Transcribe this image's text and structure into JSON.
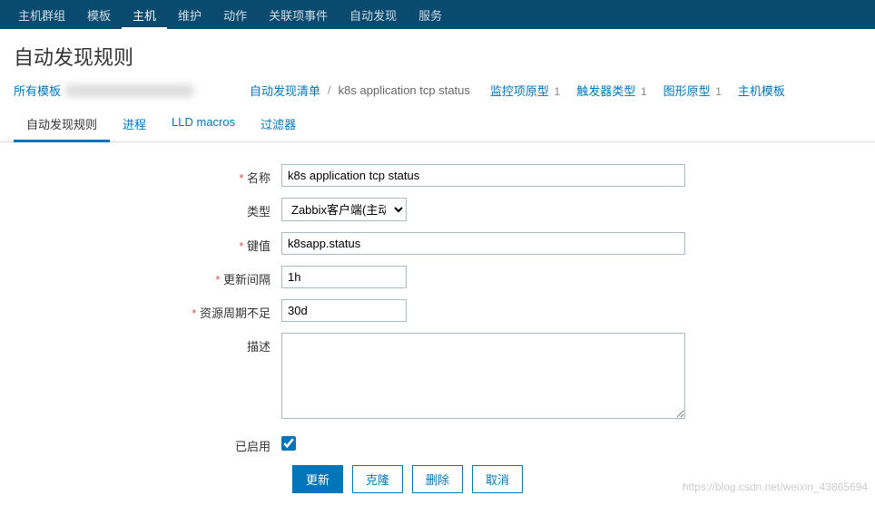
{
  "topnav": {
    "items": [
      {
        "label": "主机群组"
      },
      {
        "label": "模板"
      },
      {
        "label": "主机",
        "active": true
      },
      {
        "label": "维护"
      },
      {
        "label": "动作"
      },
      {
        "label": "关联项事件"
      },
      {
        "label": "自动发现"
      },
      {
        "label": "服务"
      }
    ]
  },
  "page_title": "自动发现规则",
  "breadcrumb": {
    "all_templates": "所有模板",
    "discovery_list": "自动发现清单",
    "current": "k8s application tcp status",
    "links": [
      {
        "label": "监控项原型",
        "count": "1"
      },
      {
        "label": "触发器类型",
        "count": "1"
      },
      {
        "label": "图形原型",
        "count": "1"
      },
      {
        "label": "主机模板"
      }
    ]
  },
  "tabs": [
    {
      "label": "自动发现规则",
      "active": true
    },
    {
      "label": "进程"
    },
    {
      "label": "LLD macros"
    },
    {
      "label": "过滤器"
    }
  ],
  "form": {
    "name_label": "名称",
    "name_value": "k8s application tcp status",
    "type_label": "类型",
    "type_value": "Zabbix客户端(主动式)",
    "key_label": "键值",
    "key_value": "k8sapp.status",
    "interval_label": "更新间隔",
    "interval_value": "1h",
    "resource_label": "资源周期不足",
    "resource_value": "30d",
    "desc_label": "描述",
    "desc_value": "",
    "enabled_label": "已启用",
    "enabled_checked": true
  },
  "buttons": {
    "update": "更新",
    "clone": "克隆",
    "delete": "删除",
    "cancel": "取消"
  },
  "watermark": "https://blog.csdn.net/weixin_43865694"
}
